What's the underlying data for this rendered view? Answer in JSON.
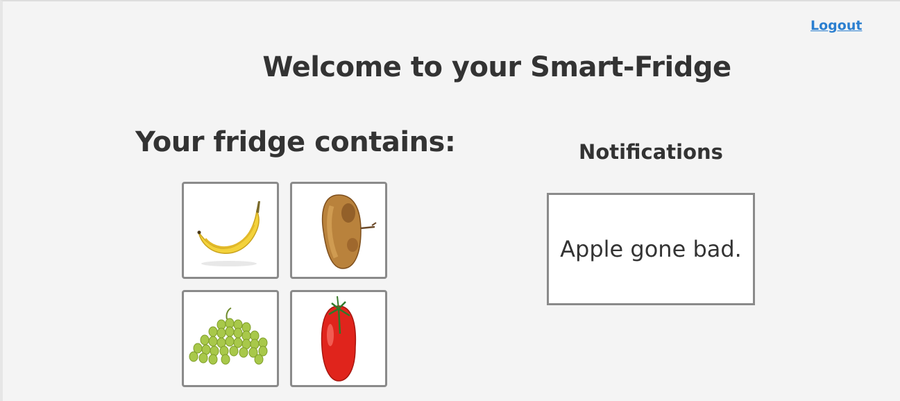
{
  "header": {
    "logout_label": "Logout",
    "title": "Welcome to your Smart-Fridge"
  },
  "fridge": {
    "heading": "Your fridge contains:",
    "items": [
      {
        "icon": "banana-icon"
      },
      {
        "icon": "rotten-apple-icon"
      },
      {
        "icon": "grapes-icon"
      },
      {
        "icon": "tomato-icon"
      }
    ]
  },
  "notifications": {
    "heading": "Notifications",
    "messages": [
      "Apple gone bad."
    ]
  },
  "colors": {
    "background": "#f4f4f4",
    "text": "#333333",
    "link": "#2b7fd0",
    "tile_border": "#8a8a8a"
  }
}
